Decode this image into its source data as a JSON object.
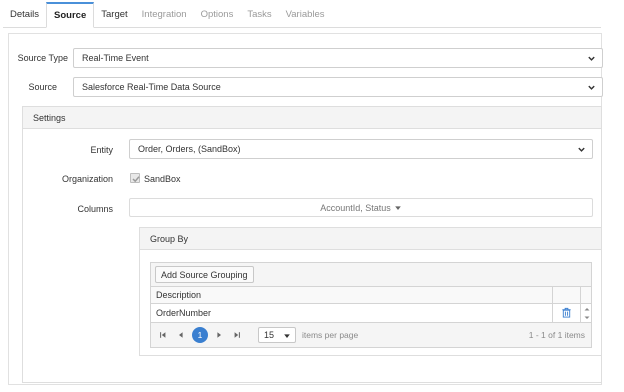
{
  "tabs": [
    {
      "label": "Details",
      "state": "enabled"
    },
    {
      "label": "Source",
      "state": "active"
    },
    {
      "label": "Target",
      "state": "enabled"
    },
    {
      "label": "Integration",
      "state": "disabled"
    },
    {
      "label": "Options",
      "state": "disabled"
    },
    {
      "label": "Tasks",
      "state": "disabled"
    },
    {
      "label": "Variables",
      "state": "disabled"
    }
  ],
  "source": {
    "source_type_label": "Source Type",
    "source_type_value": "Real-Time Event",
    "source_label": "Source",
    "source_value": "Salesforce Real-Time Data Source"
  },
  "settings": {
    "title": "Settings",
    "entity_label": "Entity",
    "entity_value": "Order, Orders, (SandBox)",
    "organization_label": "Organization",
    "organization_value": "SandBox",
    "organization_checked": true,
    "columns_label": "Columns",
    "columns_value": "AccountId, Status"
  },
  "group_by": {
    "title": "Group By",
    "add_button": "Add Source Grouping",
    "column_header": "Description",
    "rows": [
      {
        "description": "OrderNumber"
      }
    ],
    "pager": {
      "current_page": "1",
      "page_size": "15",
      "items_per_page_label": "items per page",
      "summary": "1 - 1 of 1 items"
    }
  },
  "colors": {
    "accent": "#3a7fd0",
    "tab_border_top": "#4a90d9"
  }
}
